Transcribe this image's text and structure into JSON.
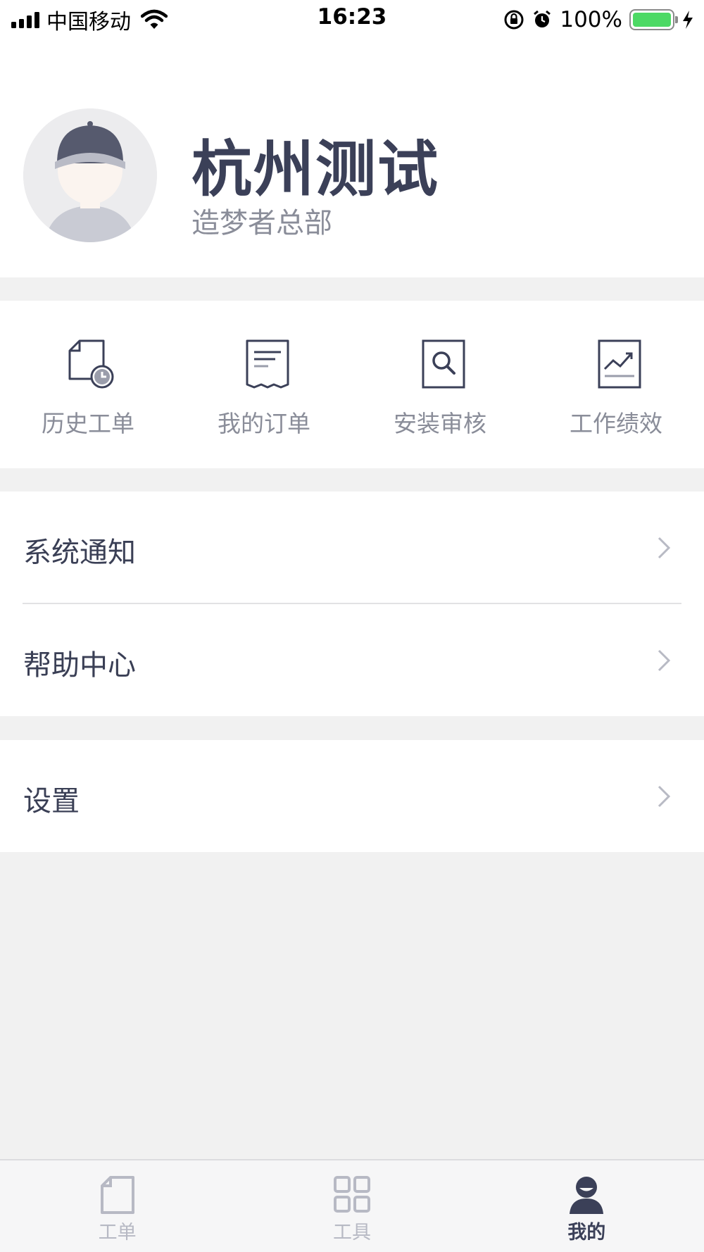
{
  "status_bar": {
    "carrier": "中国移动",
    "time": "16:23",
    "battery": "100%",
    "icons": [
      "signal-icon",
      "wifi-icon",
      "orientation-lock-icon",
      "alarm-icon",
      "battery-icon",
      "charging-icon"
    ]
  },
  "profile": {
    "name": "杭州测试",
    "organization": "造梦者总部",
    "avatar_icon": "user-avatar-icon"
  },
  "quick_actions": [
    {
      "label": "历史工单",
      "icon": "document-clock-icon"
    },
    {
      "label": "我的订单",
      "icon": "receipt-icon"
    },
    {
      "label": "安装审核",
      "icon": "document-search-icon"
    },
    {
      "label": "工作绩效",
      "icon": "trend-chart-icon"
    }
  ],
  "menu": {
    "group1": [
      {
        "label": "系统通知"
      },
      {
        "label": "帮助中心"
      }
    ],
    "group2": [
      {
        "label": "设置"
      }
    ]
  },
  "tab_bar": {
    "tabs": [
      {
        "label": "工单",
        "icon": "document-icon",
        "active": false
      },
      {
        "label": "工具",
        "icon": "grid-icon",
        "active": false
      },
      {
        "label": "我的",
        "icon": "user-icon",
        "active": true
      }
    ]
  },
  "colors": {
    "primary_text": "#3b4058",
    "secondary_text": "#8a8d99",
    "background": "#f1f1f1",
    "battery": "#4cd964",
    "tab_inactive": "#b7b9c4"
  }
}
